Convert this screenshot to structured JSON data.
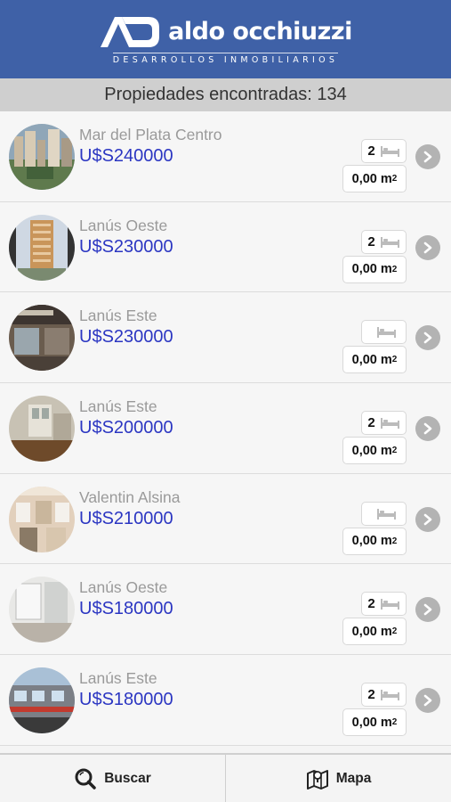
{
  "header": {
    "brand_name": "aldo occhiuzzi",
    "brand_sub": "DESARROLLOS INMOBILIARIOS",
    "background": "#3f61a7"
  },
  "results": {
    "label": "Propiedades encontradas: 134"
  },
  "listings": [
    {
      "location": "Mar del Plata Centro",
      "price": "U$S240000",
      "beds": "2",
      "area": "0,00 m",
      "area_unit_sup": "2",
      "thumb": "city"
    },
    {
      "location": "Lanús Oeste",
      "price": "U$S230000",
      "beds": "2",
      "area": "0,00 m",
      "area_unit_sup": "2",
      "thumb": "tower"
    },
    {
      "location": "Lanús Este",
      "price": "U$S230000",
      "beds": "",
      "area": "0,00 m",
      "area_unit_sup": "2",
      "thumb": "shop"
    },
    {
      "location": "Lanús Este",
      "price": "U$S200000",
      "beds": "2",
      "area": "0,00 m",
      "area_unit_sup": "2",
      "thumb": "room"
    },
    {
      "location": "Valentin Alsina",
      "price": "U$S210000",
      "beds": "",
      "area": "0,00 m",
      "area_unit_sup": "2",
      "thumb": "facade"
    },
    {
      "location": "Lanús Oeste",
      "price": "U$S180000",
      "beds": "2",
      "area": "0,00 m",
      "area_unit_sup": "2",
      "thumb": "interior"
    },
    {
      "location": "Lanús Este",
      "price": "U$S180000",
      "beds": "2",
      "area": "0,00 m",
      "area_unit_sup": "2",
      "thumb": "street"
    }
  ],
  "footer": {
    "search_label": "Buscar",
    "map_label": "Mapa"
  },
  "colors": {
    "price": "#2b36c2",
    "location": "#9a9a9a",
    "results_bar": "#cfcfcf"
  }
}
